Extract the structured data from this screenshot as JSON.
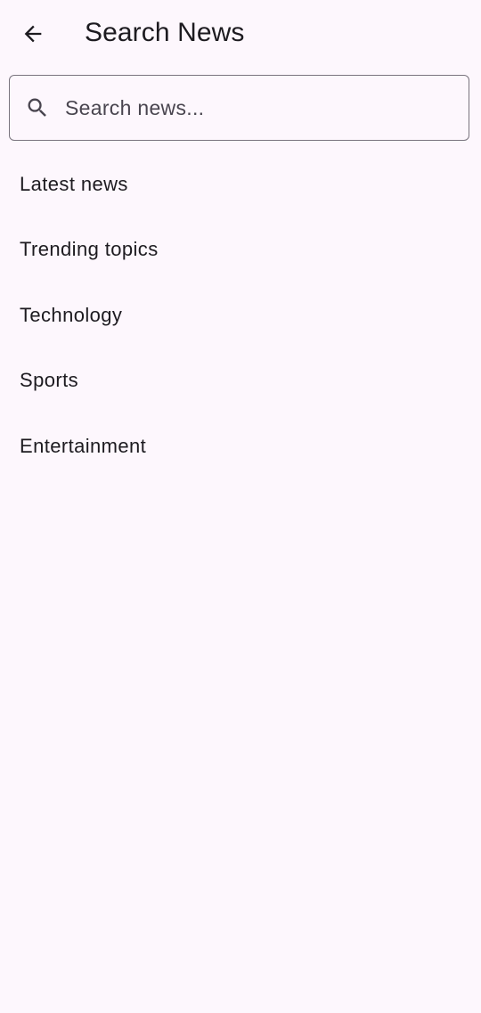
{
  "app_bar": {
    "title": "Search News",
    "back_icon": "arrow-back-icon"
  },
  "search": {
    "placeholder": "Search news...",
    "value": "",
    "icon": "search-icon"
  },
  "suggestions": [
    {
      "label": "Latest news"
    },
    {
      "label": "Trending topics"
    },
    {
      "label": "Technology"
    },
    {
      "label": "Sports"
    },
    {
      "label": "Entertainment"
    }
  ],
  "colors": {
    "background": "#fdf7fd",
    "text": "#1d1b20",
    "outline": "#79747e",
    "placeholder": "#49454f"
  }
}
